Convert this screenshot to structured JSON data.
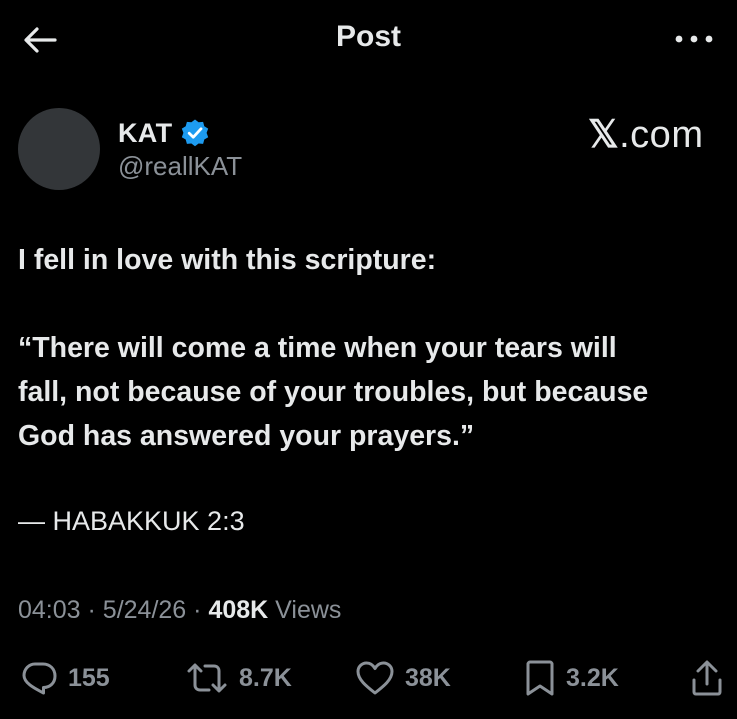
{
  "header": {
    "title": "Post"
  },
  "author": {
    "display_name": "KAT",
    "handle": "@reallKAT",
    "verified": true
  },
  "watermark": {
    "x": "𝕏",
    "domain": ".com"
  },
  "tweet": {
    "line1": "I fell in love with this scripture:",
    "quote_line1": "“There will come a time when your tears will",
    "quote_line2": "fall, not because of your troubles, but because",
    "quote_line3": "God has answered your prayers.”",
    "attribution": "— HABAKKUK 2:3"
  },
  "meta": {
    "time": "04:03",
    "date": "5/24/26",
    "separator": "·",
    "views_count": "408K",
    "views_label": "Views"
  },
  "actions": {
    "replies": "155",
    "reposts": "8.7K",
    "likes": "38K",
    "bookmarks": "3.2K"
  },
  "colors": {
    "background": "#000000",
    "text": "#e7e9ea",
    "secondary": "#8b9198",
    "verified": "#1d9bf0"
  }
}
